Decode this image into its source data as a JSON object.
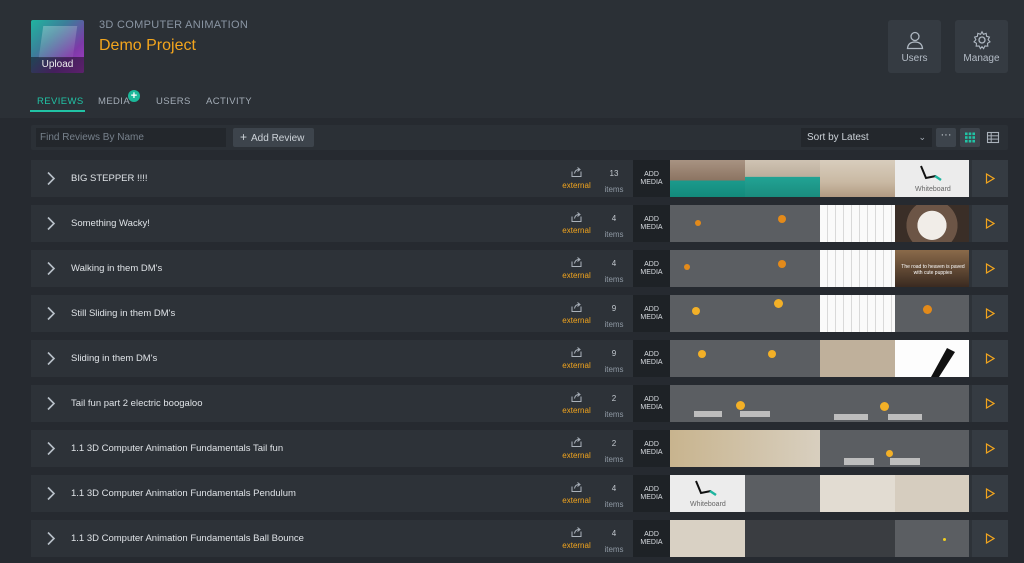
{
  "header": {
    "upload_label": "Upload",
    "kicker": "3D COMPUTER ANIMATION",
    "project_title": "Demo Project",
    "users_label": "Users",
    "manage_label": "Manage"
  },
  "tabs": [
    {
      "label": "REVIEWS",
      "active": true
    },
    {
      "label": "MEDIA",
      "active": false
    },
    {
      "label": "USERS",
      "active": false
    },
    {
      "label": "ACTIVITY",
      "active": false
    }
  ],
  "media_badge": "+",
  "toolbar": {
    "search_placeholder": "Find Reviews By Name",
    "add_review_label": "Add Review",
    "sort_label": "Sort by Latest",
    "more_label": "···"
  },
  "colors": {
    "accent": "#21c3a5",
    "brand": "#f3a51d",
    "background": "#262a30",
    "row": "#2d3238"
  },
  "icons": {
    "users": "user-icon",
    "manage": "gear-icon",
    "share": "share-icon",
    "play": "play-icon",
    "expand": "chevron-right-icon"
  },
  "reviews": [
    {
      "name": "BIG STEPPER !!!!",
      "share_label": "external",
      "count": "13",
      "items_label": "items",
      "add_media_label": "ADD MEDIA",
      "whiteboard_label": "Whiteboard"
    },
    {
      "name": "Something Wacky!",
      "share_label": "external",
      "count": "4",
      "items_label": "items",
      "add_media_label": "ADD MEDIA"
    },
    {
      "name": "Walking in them DM's",
      "share_label": "external",
      "count": "4",
      "items_label": "items",
      "add_media_label": "ADD MEDIA",
      "caption": "The road to heaven is paved with cute puppies"
    },
    {
      "name": "Still Sliding in them DM's",
      "share_label": "external",
      "count": "9",
      "items_label": "items",
      "add_media_label": "ADD MEDIA"
    },
    {
      "name": "Sliding in them DM's",
      "share_label": "external",
      "count": "9",
      "items_label": "items",
      "add_media_label": "ADD MEDIA"
    },
    {
      "name": "Tail fun part 2 electric boogaloo",
      "share_label": "external",
      "count": "2",
      "items_label": "items",
      "add_media_label": "ADD MEDIA"
    },
    {
      "name": "1.1 3D Computer Animation Fundamentals Tail fun",
      "share_label": "external",
      "count": "2",
      "items_label": "items",
      "add_media_label": "ADD MEDIA"
    },
    {
      "name": "1.1 3D Computer Animation Fundamentals Pendulum",
      "share_label": "external",
      "count": "4",
      "items_label": "items",
      "add_media_label": "ADD MEDIA",
      "whiteboard_label": "Whiteboard"
    },
    {
      "name": "1.1 3D Computer Animation Fundamentals Ball Bounce",
      "share_label": "external",
      "count": "4",
      "items_label": "items",
      "add_media_label": "ADD MEDIA"
    }
  ]
}
